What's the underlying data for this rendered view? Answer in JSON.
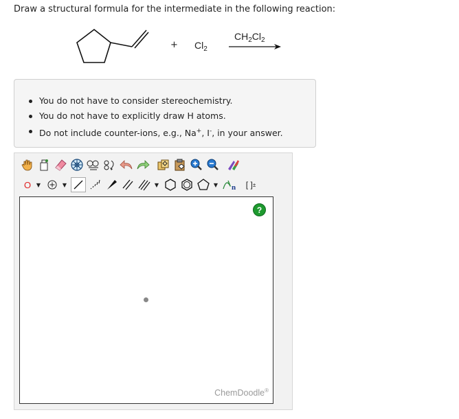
{
  "question": "Draw a structural formula for the intermediate in the following reaction:",
  "reaction": {
    "plus": "+",
    "reagent_symbol": "Cl",
    "reagent_subscript": "2",
    "condition_prefix": "CH",
    "condition_sub1": "2",
    "condition_mid": "Cl",
    "condition_sub2": "2"
  },
  "hints": [
    "You do not have to consider stereochemistry.",
    "You do not have to explicitly draw H atoms.",
    "Do not include counter-ions, e.g., Na",
    "+",
    ", I",
    "-",
    ", in your answer."
  ],
  "editor": {
    "element_label": "O",
    "help_label": "?",
    "brand": "ChemDoodle",
    "brand_mark": "®",
    "bracket_label": "[ ]",
    "bracket_sup": "±",
    "sgroup_label": "n"
  },
  "colors": {
    "help_green": "#1e9a2f",
    "element_red": "#e02020",
    "hint_bg": "#f5f5f5"
  }
}
